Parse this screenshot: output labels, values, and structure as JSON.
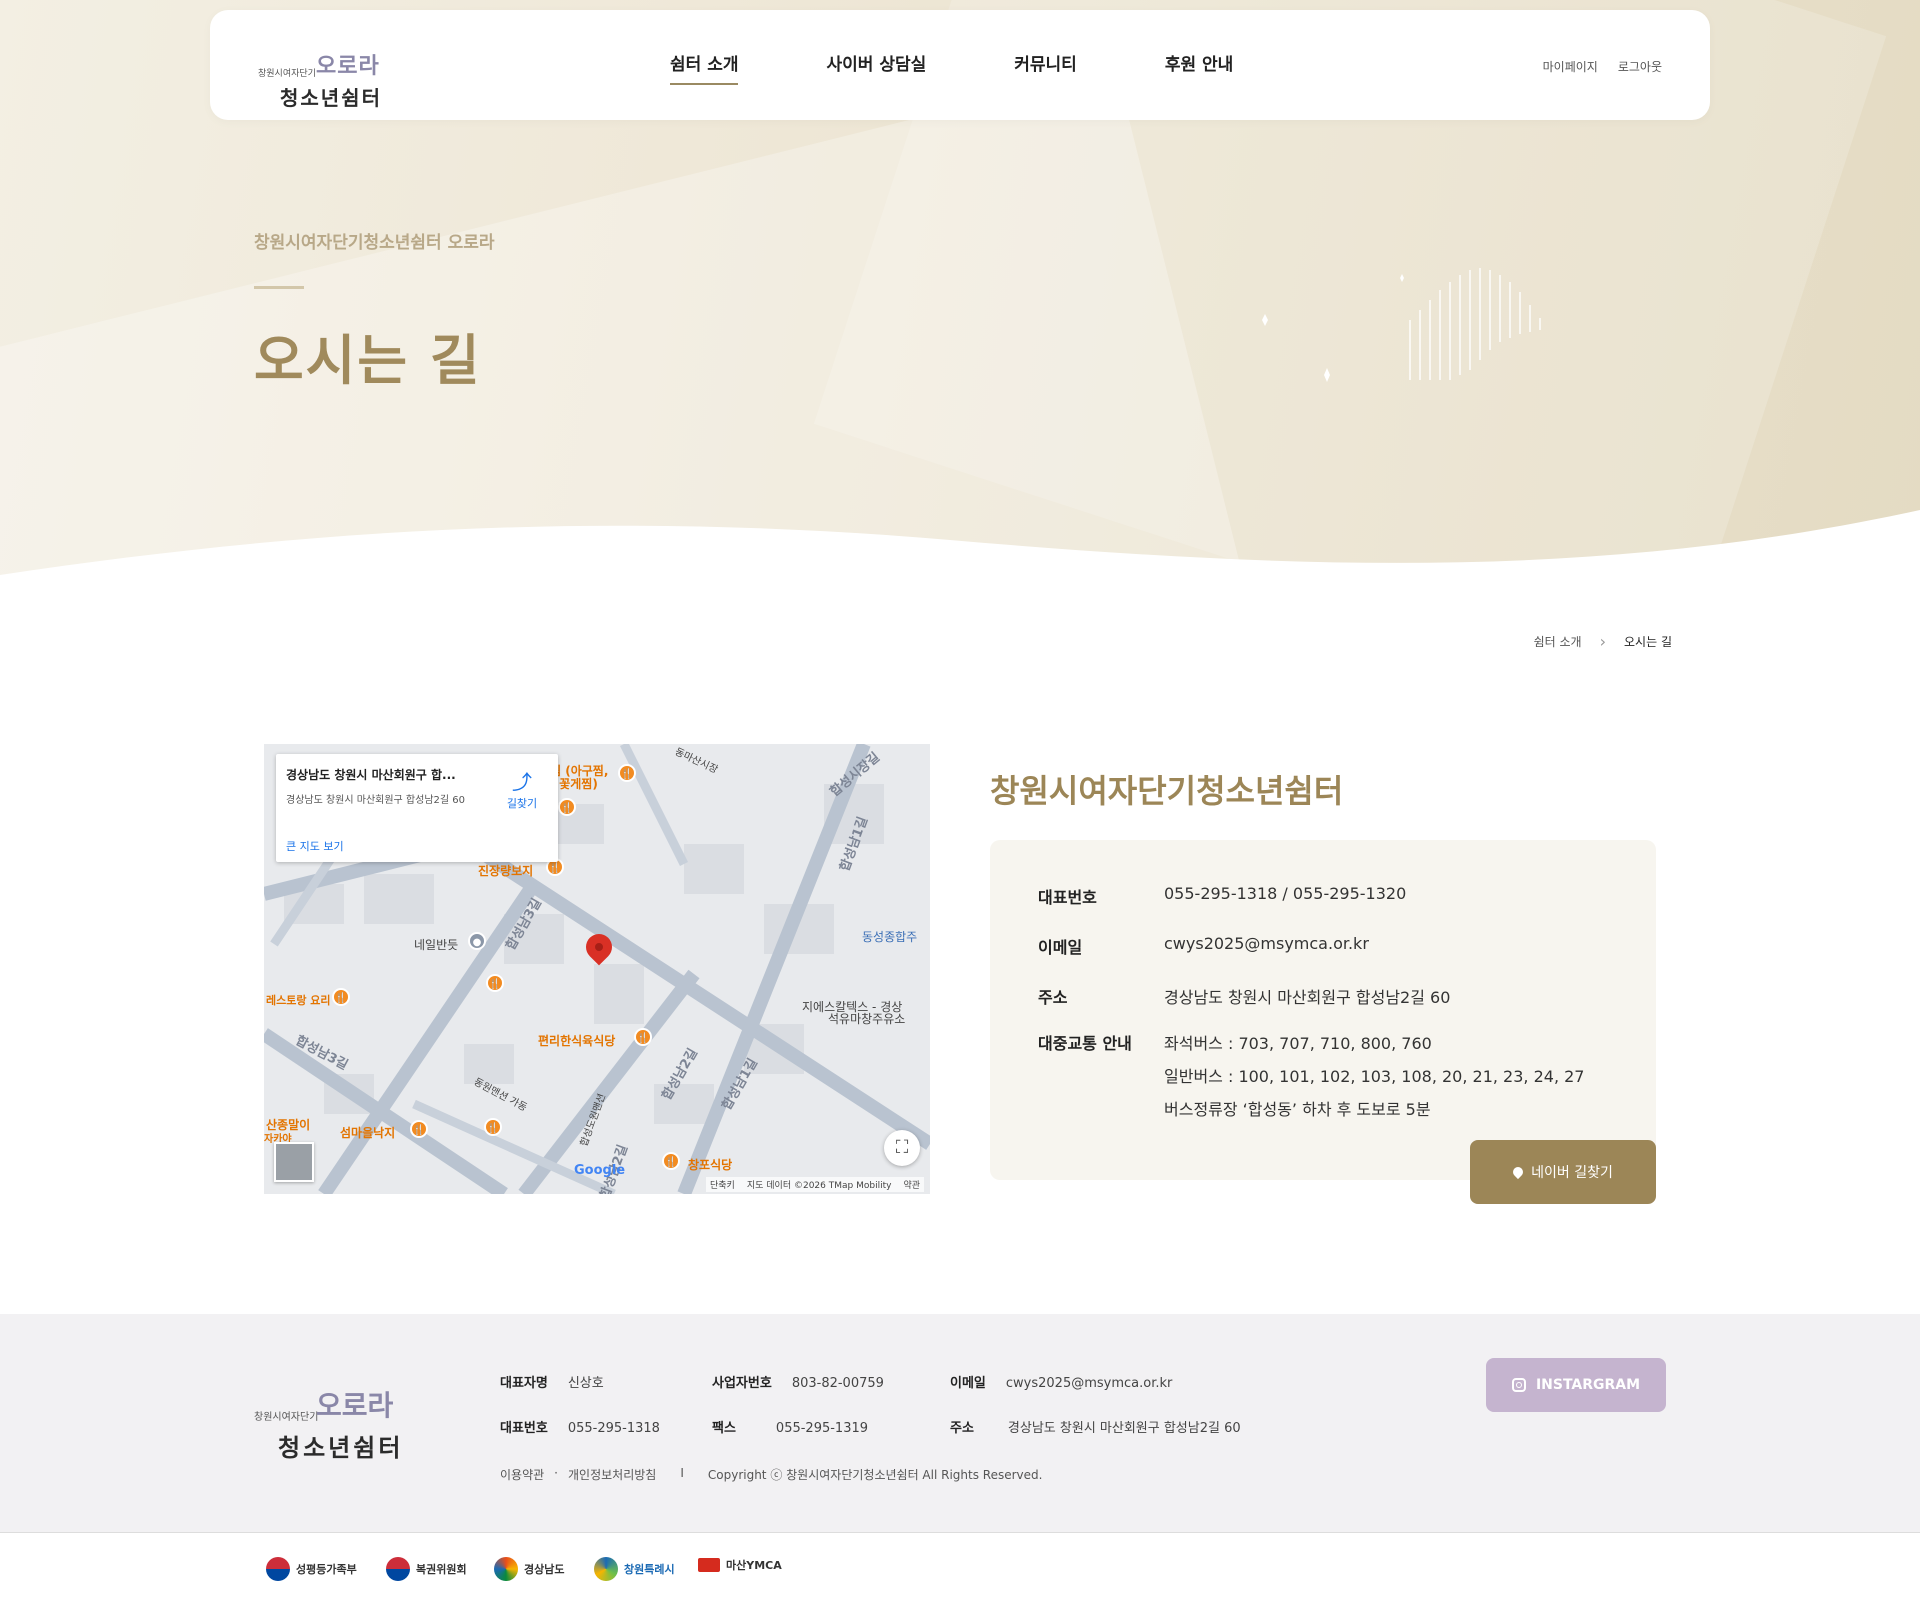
{
  "header": {
    "logo": {
      "small": "창원시여자단기",
      "brand": "오로라",
      "main": "청소년쉼터"
    },
    "nav": [
      "쉼터 소개",
      "사이버 상담실",
      "커뮤니티",
      "후원 안내"
    ],
    "util": {
      "mypage": "마이페이지",
      "logout": "로그아웃"
    }
  },
  "hero": {
    "subtitle": "창원시여자단기청소년쉼터 오로라",
    "title": "오시는 길"
  },
  "breadcrumb": {
    "parent": "쉼터 소개",
    "current": "오시는 길"
  },
  "map": {
    "card_title": "경상남도 창원시 마산회원구 합...",
    "card_address": "경상남도 창원시 마산회원구 합성남2길 60",
    "directions": "길찾기",
    "bigmap": "큰 지도 보기",
    "labels": {
      "l1": "찜 (아구찜,",
      "l2": "찜 꽃게찜)",
      "l3": "동마산시장",
      "l4": "합성시장길",
      "l5": "진장량보지",
      "l6": "합성남1길",
      "l7": "합성남3길",
      "l8": "네일반듯",
      "l9": "동성종합주",
      "l10": "레스토랑 요리",
      "l11": "지에스칼텍스 - 경상",
      "l12": "석유마창주유소",
      "l13": "편리한식육식당",
      "l14": "합성남3길",
      "l15": "합성남2길",
      "l16": "합성남1길",
      "l17": "동원맨션 가동",
      "l18": "합성도원맨션",
      "l19": "산종말이",
      "l20": "자카야",
      "l21": "섬마을낙지",
      "l22": "창포식당",
      "l23": "합성남2길"
    },
    "google": "Google",
    "footer": [
      "단축키",
      "지도 데이터 ©2026 TMap Mobility",
      "약관"
    ]
  },
  "info": {
    "title": "창원시여자단기청소년쉼터",
    "rows": [
      {
        "key": "대표번호",
        "value": "055-295-1318 / 055-295-1320"
      },
      {
        "key": "이메일",
        "value": "cwys2025@msymca.or.kr"
      },
      {
        "key": "주소",
        "value": "경상남도 창원시 마산회원구 합성남2길 60"
      },
      {
        "key": "대중교통 안내",
        "lines": [
          "좌석버스 : 703, 707, 710, 800, 760",
          "일반버스 : 100, 101, 102, 103, 108, 20, 21, 23, 24, 27",
          "버스정류장 ‘합성동’ 하차 후 도보로 5분"
        ]
      }
    ],
    "naver_button": "네이버 길찾기"
  },
  "footer": {
    "logo": {
      "small": "창원시여자단기",
      "brand": "오로라",
      "main": "청소년쉼터"
    },
    "ceo_label": "대표자명",
    "ceo": "신상호",
    "biz_label": "사업자번호",
    "biz": "803-82-00759",
    "email_label": "이메일",
    "email": "cwys2025@msymca.or.kr",
    "tel_label": "대표번호",
    "tel": "055-295-1318",
    "fax_label": "팩스",
    "fax": "055-295-1319",
    "addr_label": "주소",
    "addr": "경상남도 창원시 마산회원구 합성남2길 60",
    "terms": "이용약관",
    "privacy": "개인정보처리방침",
    "dot": "·",
    "bar": "I",
    "copyright": "Copyright ⓒ 창원시여자단기청소년쉼터 All Rights Reserved.",
    "instagram": "INSTARGRAM"
  },
  "partners": [
    "성평등가족부",
    "복권위원회",
    "경상남도",
    "창원특례시",
    "마산YMCA"
  ],
  "colors": {
    "accent": "#9c8657",
    "instagram": "#c5b4cf",
    "hero_bg": "#efe8d8"
  }
}
